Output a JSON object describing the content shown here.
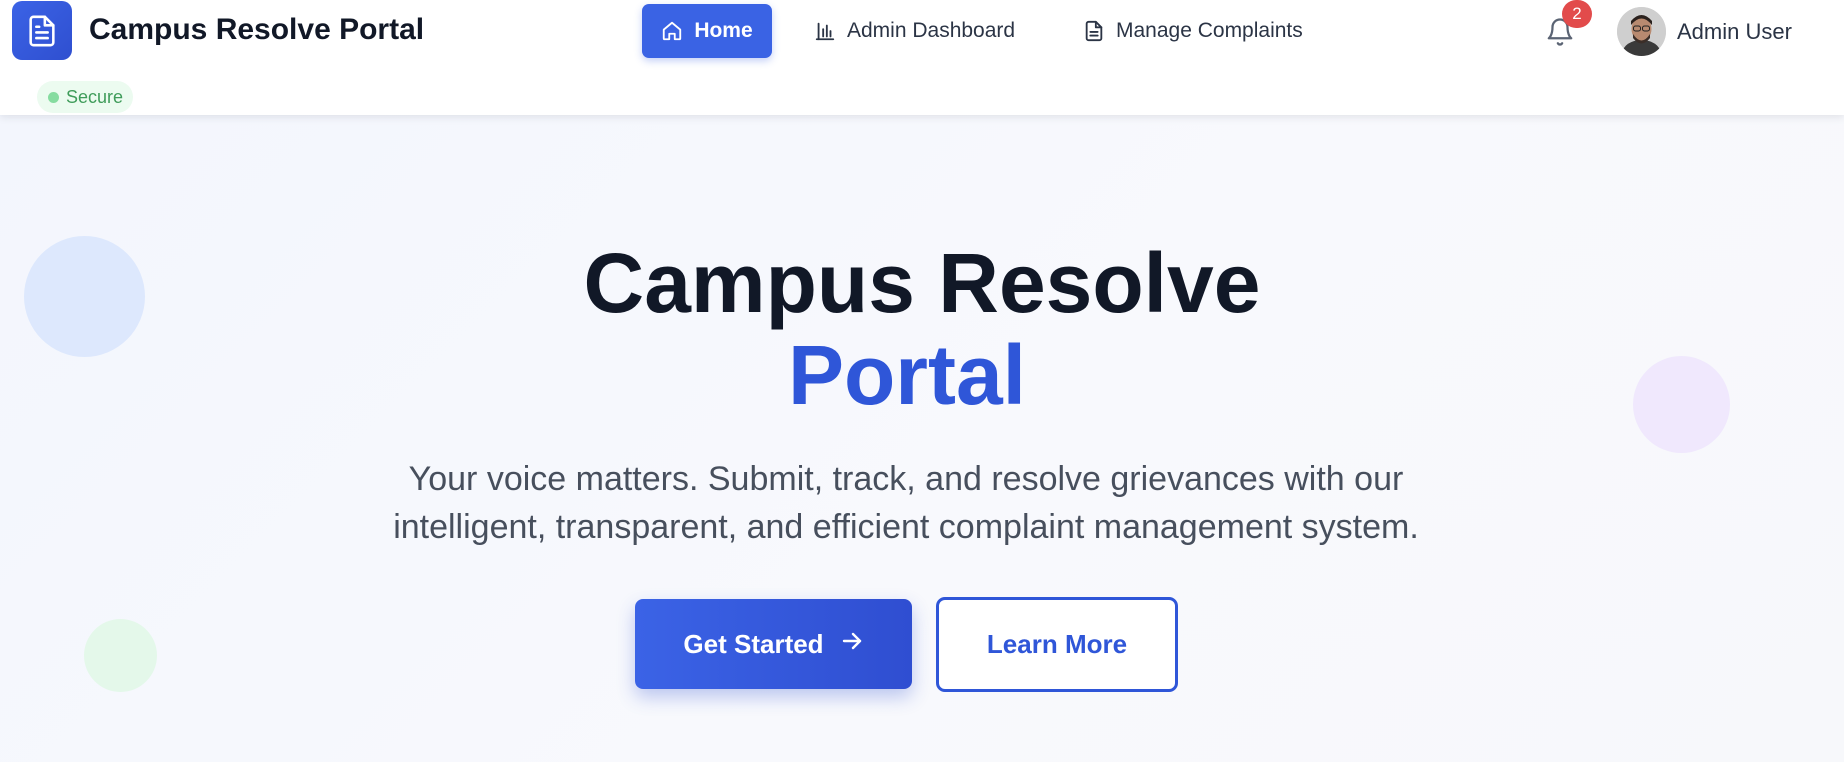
{
  "header": {
    "brand_title": "Campus Resolve Portal",
    "secure_label": "Secure",
    "nav": {
      "home": "Home",
      "admin_dashboard": "Admin Dashboard",
      "manage_complaints": "Manage Complaints"
    },
    "notification_count": "2",
    "user_name": "Admin User",
    "icons": [
      "document-icon",
      "home-icon",
      "bar-chart-icon",
      "file-text-icon",
      "bell-icon",
      "avatar"
    ]
  },
  "hero": {
    "title": "Campus Resolve",
    "title_accent": "Portal",
    "subtitle_line1": "Your voice matters. Submit, track, and resolve grievances with our",
    "subtitle_line2": "intelligent, transparent, and efficient complaint management system.",
    "primary_button": "Get Started",
    "secondary_button": "Learn More"
  },
  "colors": {
    "accent": "#3a63e4",
    "accent_dark": "#2f56d8",
    "badge_red": "#e24b4b",
    "secure_green": "#3f9c5a"
  }
}
